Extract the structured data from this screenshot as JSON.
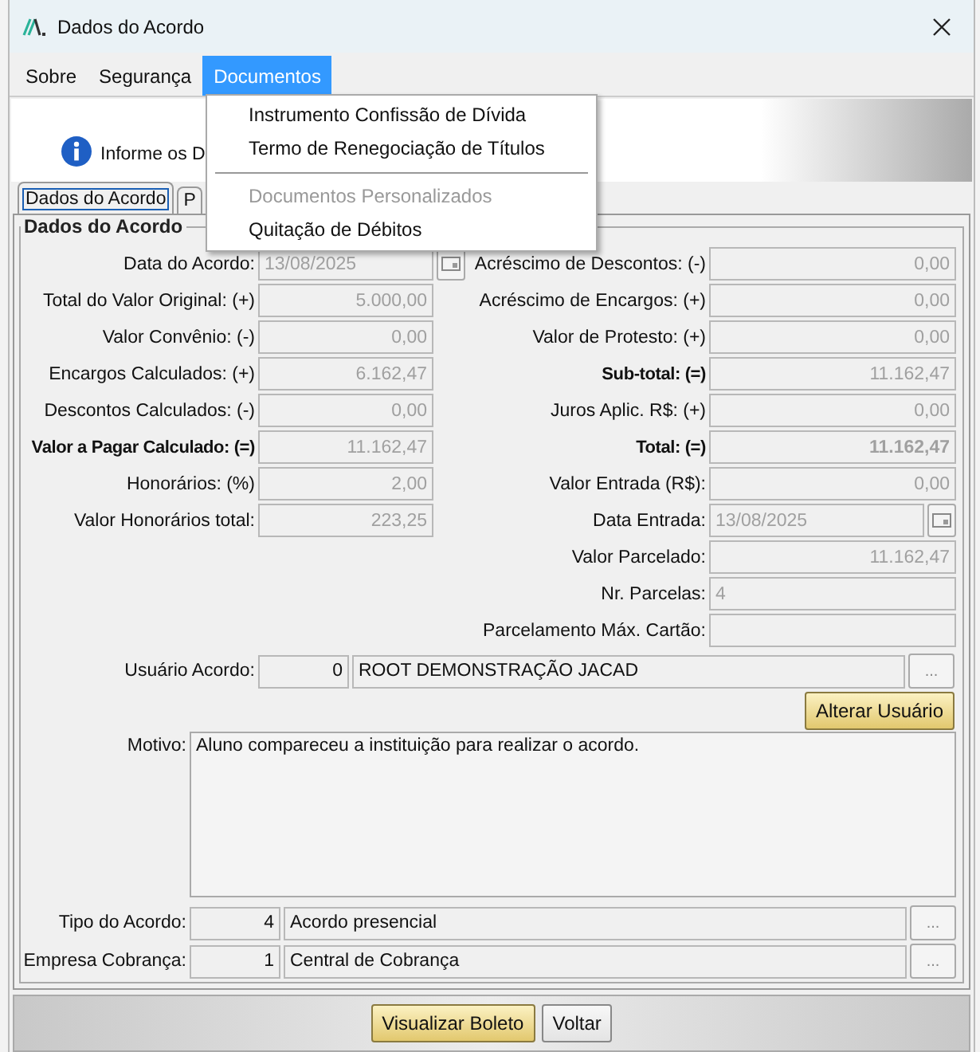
{
  "window": {
    "title": "Dados do Acordo"
  },
  "menu_bar": [
    {
      "label": "Sobre",
      "selected": false
    },
    {
      "label": "Segurança",
      "selected": false
    },
    {
      "label": "Documentos",
      "selected": true
    }
  ],
  "open_menu": [
    {
      "kind": "item",
      "label": "Instrumento Confissão de Dívida",
      "disabled": false
    },
    {
      "kind": "item",
      "label": "Termo de Renegociação de Títulos",
      "disabled": false
    },
    {
      "kind": "separator"
    },
    {
      "kind": "item",
      "label": "Documentos Personalizados",
      "disabled": true
    },
    {
      "kind": "item",
      "label": "Quitação de Débitos",
      "disabled": false
    }
  ],
  "header": {
    "message": "Informe os D"
  },
  "tabs": [
    {
      "label": "Dados do Acordo",
      "selected": true
    },
    {
      "label": "P",
      "selected": false
    }
  ],
  "group": {
    "title": "Dados do Acordo",
    "left_rows": [
      {
        "label": "Data do Acordo:",
        "value": "13/08/2025",
        "kind": "date",
        "bold": false
      },
      {
        "label": "Total do Valor Original: (+)",
        "value": "5.000,00",
        "kind": "amount",
        "bold": false
      },
      {
        "label": "Valor Convênio: (-)",
        "value": "0,00",
        "kind": "amount",
        "bold": false
      },
      {
        "label": "Encargos Calculados: (+)",
        "value": "6.162,47",
        "kind": "amount",
        "bold": false
      },
      {
        "label": "Descontos Calculados: (-)",
        "value": "0,00",
        "kind": "amount",
        "bold": false
      },
      {
        "label": "Valor a Pagar Calculado: (=)",
        "value": "11.162,47",
        "kind": "amount",
        "bold": true
      },
      {
        "label": "Honorários: (%)",
        "value": "2,00",
        "kind": "amount",
        "bold": false
      },
      {
        "label": "Valor Honorários total:",
        "value": "223,25",
        "kind": "amount",
        "bold": false
      }
    ],
    "right_rows": [
      {
        "label": "Acréscimo de Descontos: (-)",
        "value": "0,00",
        "kind": "amount",
        "bold": false
      },
      {
        "label": "Acréscimo de Encargos: (+)",
        "value": "0,00",
        "kind": "amount",
        "bold": false
      },
      {
        "label": "Valor de Protesto: (+)",
        "value": "0,00",
        "kind": "amount",
        "bold": false
      },
      {
        "label": "Sub-total: (=)",
        "value": "11.162,47",
        "kind": "amount",
        "bold": true
      },
      {
        "label": "Juros Aplic. R$: (+)",
        "value": "0,00",
        "kind": "amount",
        "bold": false
      },
      {
        "label": "Total: (=)",
        "value": "11.162,47",
        "kind": "amount",
        "bold": true,
        "value_bold": true
      },
      {
        "label": "Valor Entrada (R$):",
        "value": "0,00",
        "kind": "amount",
        "bold": false
      },
      {
        "label": "Data Entrada:",
        "value": "13/08/2025",
        "kind": "date",
        "bold": false
      },
      {
        "label": "Valor Parcelado:",
        "value": "11.162,47",
        "kind": "amount",
        "bold": false
      },
      {
        "label": "Nr. Parcelas:",
        "value": "4",
        "kind": "text",
        "bold": false
      },
      {
        "label": "Parcelamento Máx. Cartão:",
        "kind": "text",
        "bold": false
      }
    ],
    "user": {
      "label": "Usuário Acordo:",
      "code": "0",
      "name": "ROOT DEMONSTRAÇÃO JACAD",
      "lookup": "..."
    },
    "change_user_button": "Alterar Usuário",
    "reason": {
      "label": "Motivo:",
      "value": "Aluno compareceu a instituição para realizar o acordo."
    },
    "lookups": [
      {
        "label": "Tipo do Acordo:",
        "code": "4",
        "name": "Acordo presencial",
        "lookup": "..."
      },
      {
        "label": "Empresa Cobrança:",
        "code": "1",
        "name": "Central de Cobrança",
        "lookup": "..."
      }
    ]
  },
  "footer_buttons": [
    {
      "label": "Visualizar Boleto",
      "kind": "primary"
    },
    {
      "label": "Voltar",
      "kind": "plain"
    }
  ]
}
